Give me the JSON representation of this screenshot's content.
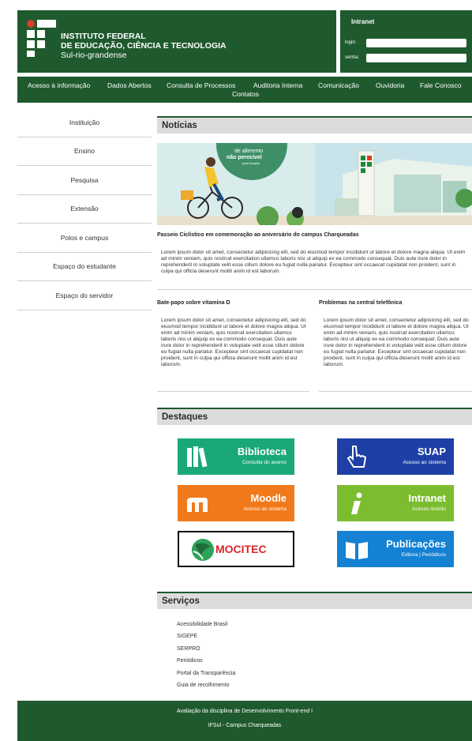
{
  "header": {
    "institution_line1": "INSTITUTO FEDERAL",
    "institution_line2": "DE EDUCAÇÃO, CIÊNCIA E TECNOLOGIA",
    "institution_sub": "Sul-rio-grandense",
    "intranet_title": "Intranet",
    "login_label": "login:",
    "password_label": "senha:"
  },
  "nav": {
    "items": [
      "Acesso à informação",
      "Dados Abertos",
      "Consulta de Processos",
      "Auditoria Interna",
      "Comunicação",
      "Ouvidoria",
      "Fale Conosco",
      "Contatos"
    ]
  },
  "sidebar": {
    "items": [
      "Instituição",
      "Ensino",
      "Pesquisa",
      "Extensão",
      "Polos e campus",
      "Espaço do estudante",
      "Espaço do servidor"
    ]
  },
  "news": {
    "section_title": "Notícias",
    "banner_text1": "de alimento",
    "banner_text2": "não perecível",
    "banner_text3": "para doação",
    "main_title": "Passeio Ciclístico em comemoração ao aniversário do campus Charqueadas",
    "main_text": "Lorem ipsum dolor sit amet, consectetur adipisicing elit, sed do eiusmod tempor incididunt ut labore et dolore magna aliqua. Ut enim ad minim veniam, quis nostrud exercitation ullamco laboris nisi ut aliquip ex ea commodo consequat. Duis aute irure dolor in reprehenderit in voluptate velit esse cillum dolore eu fugiat nulla pariatur. Excepteur sint occaecat cupidatat non proident, sunt in culpa qui officia deserunt mollit anim id est laborum.",
    "left_title": "Bate-papo sobre vitamina D",
    "left_text": "Lorem ipsum dolor sit amet, consectetur adipisicing elit, sed do eiusmod tempor incididunt ut labore et dolore magna aliqua. Ut enim ad minim veniam, quis nostrud exercitation ullamco laboris nisi ut aliquip ex ea commodo consequat. Duis aute irure dolor in reprehenderit in voluptate velit esse cillum dolore eu fugiat nulla pariatur. Excepteur sint occaecat cupidatat non proident, sunt in culpa qui officia deserunt mollit anim id est laborum.",
    "right_title": "Problemas na central telefônica",
    "right_text": "Lorem ipsum dolor sit amet, consectetur adipisicing elit, sed do eiusmod tempor incididunt ut labore et dolore magna aliqua. Ut enim ad minim veniam, quis nostrud exercitation ullamco laboris nisi ut aliquip ex ea commodo consequat. Duis aute irure dolor in reprehenderit in voluptate velit esse cillum dolore eu fugiat nulla pariatur. Excepteur sint occaecat cupidatat non proident, sunt in culpa qui officia deserunt mollit anim id est laborum."
  },
  "destaques": {
    "section_title": "Destaques",
    "biblioteca": {
      "title": "Biblioteca",
      "sub": "Consulta do acervo",
      "color": "#1aa877"
    },
    "suap": {
      "title": "SUAP",
      "sub": "Acesso ao sistema",
      "color": "#1d3fa6"
    },
    "moodle": {
      "title": "Moodle",
      "sub": "Acesso ao sistema",
      "color": "#f07a1b"
    },
    "intranet": {
      "title": "Intranet",
      "sub": "Acesso restrito",
      "color": "#7cbd2f"
    },
    "mocitec": {
      "title": "MOCITEC",
      "color": "#d9262b"
    },
    "publicacoes": {
      "title": "Publicações",
      "sub": "Editora | Periódicos",
      "color": "#1581d3"
    }
  },
  "servicos": {
    "section_title": "Serviços",
    "items": [
      "Acessibilidade Brasil",
      "SIGEPE",
      "SERPRO",
      "Periódicos",
      "Portal da Transparência",
      "Guia de recolhimento"
    ]
  },
  "footer": {
    "line1": "Avaliação da disciplina de Desenvolvimento Front-end I",
    "line2": "IFSul - Campus Charqueadas"
  },
  "colors": {
    "brand_green": "#1f5a2e",
    "section_gray": "#dcdcdc"
  }
}
